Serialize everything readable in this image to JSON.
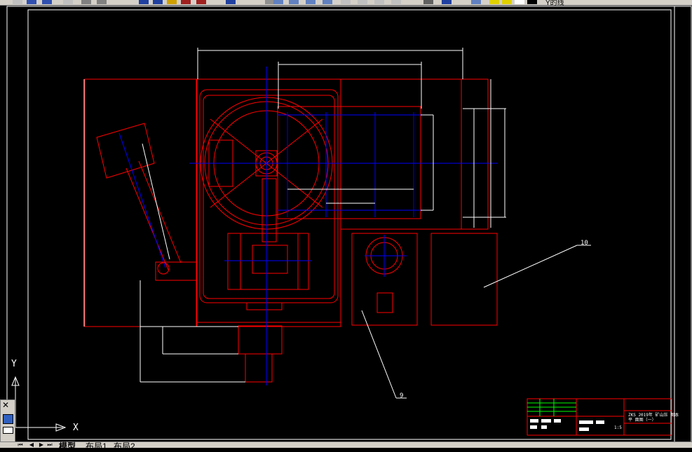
{
  "toolbar": {
    "status_text": "Y的线"
  },
  "drawing": {
    "labels": {
      "callout_10": "10",
      "callout_9": "9"
    },
    "ucs": {
      "y_label": "Y",
      "x_label": "X"
    },
    "title_block": {
      "line1": "ZKS 2019年 矿山压 图本",
      "line2": "平 面图（一）",
      "scale": "1:5"
    },
    "colors": {
      "background": "#000000",
      "outline": "#ff0000",
      "center": "#0000ff",
      "dimension": "#ffffff",
      "frame": "#ffffff",
      "table": "#00ff00"
    }
  },
  "tabs": {
    "model": "模型",
    "layout1": "布局1",
    "layout2": "布局2"
  }
}
